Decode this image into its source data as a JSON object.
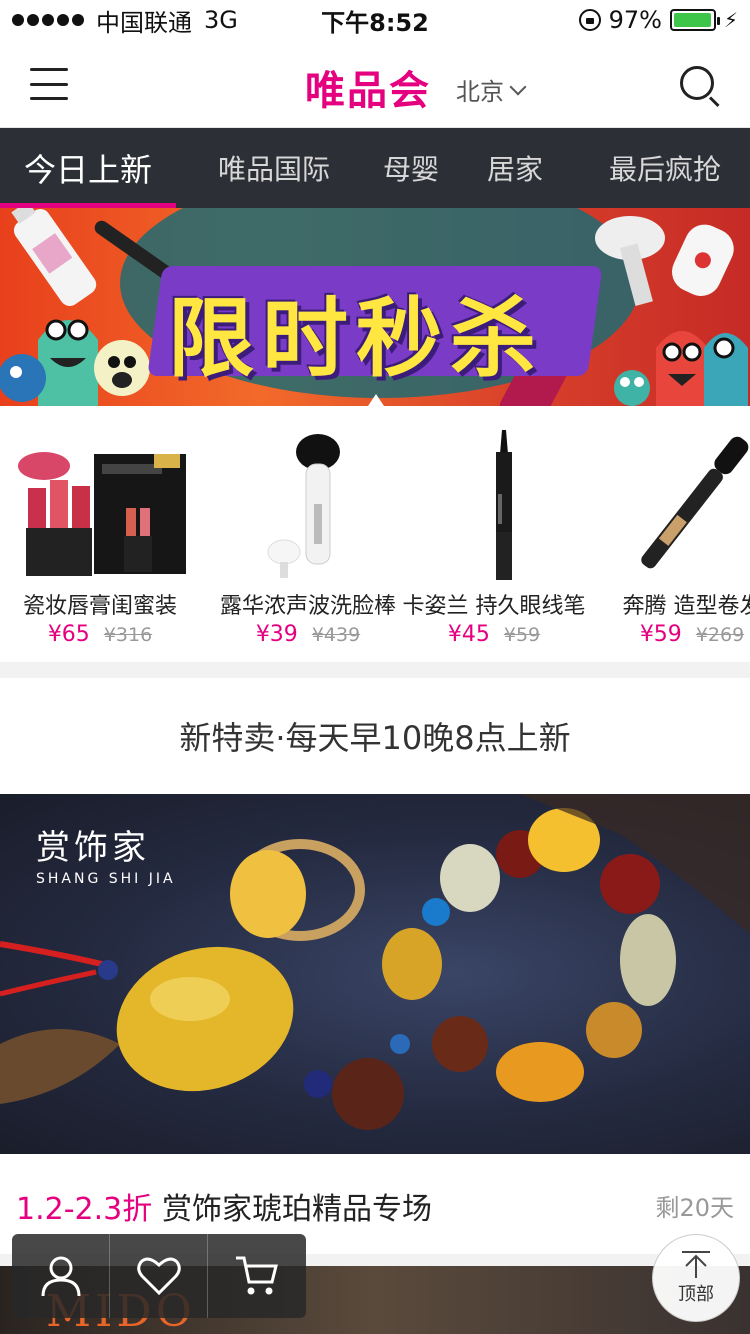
{
  "status_bar": {
    "carrier": "中国联通",
    "network": "3G",
    "time": "下午8:52",
    "battery_percent": "97%",
    "battery_level": 0.97
  },
  "header": {
    "brand": "唯品会",
    "city": "北京",
    "menu_icon": "hamburger-menu-icon",
    "search_icon": "search-icon"
  },
  "tabs": [
    {
      "label": "今日上新",
      "active": true
    },
    {
      "label": "唯品国际",
      "active": false
    },
    {
      "label": "母婴",
      "active": false
    },
    {
      "label": "居家",
      "active": false
    },
    {
      "label": "最后疯抢",
      "active": false
    }
  ],
  "banner": {
    "text": "限时秒杀"
  },
  "flash_sale": [
    {
      "name": "瓷妆唇膏闺蜜装",
      "price": "¥65",
      "original_price": "¥316"
    },
    {
      "name": "露华浓声波洗脸棒",
      "price": "¥39",
      "original_price": "¥439"
    },
    {
      "name": "卡姿兰 持久眼线笔",
      "price": "¥45",
      "original_price": "¥59"
    },
    {
      "name": "奔腾 造型卷发",
      "price": "¥59",
      "original_price": "¥269"
    }
  ],
  "section_title": "新特卖·每天早10晚8点上新",
  "card": {
    "brand_cn": "赏饰家",
    "brand_en": "SHANG SHI JIA",
    "discount": "1.2-2.3折",
    "title": "赏饰家琥珀精品专场",
    "remaining": "剩20天"
  },
  "next_card": {
    "brand": "MIDO"
  },
  "bottom_bar": {
    "icons": [
      "user-icon",
      "heart-icon",
      "cart-icon"
    ]
  },
  "back_to_top": {
    "label": "顶部"
  },
  "colors": {
    "accent": "#e4007f",
    "tab_bar": "#2c2f36",
    "battery": "#3ec64a"
  }
}
